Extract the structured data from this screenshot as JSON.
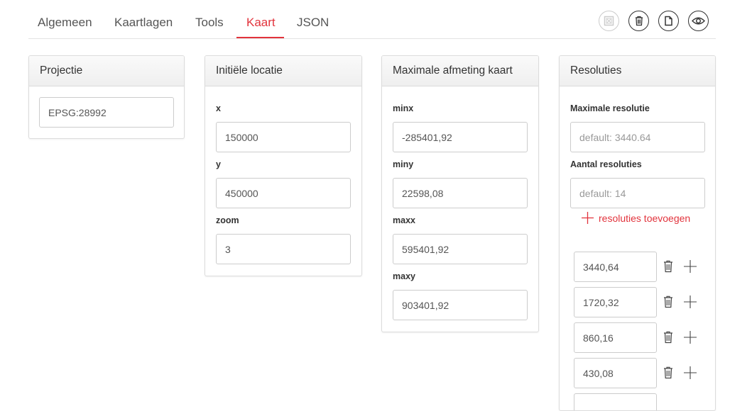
{
  "tabs": [
    {
      "label": "Algemeen"
    },
    {
      "label": "Kaartlagen"
    },
    {
      "label": "Tools"
    },
    {
      "label": "Kaart",
      "active": true
    },
    {
      "label": "JSON"
    }
  ],
  "toolbar": {
    "icons": [
      "close-box-icon",
      "trash-icon",
      "document-icon",
      "eye-icon"
    ]
  },
  "projectie": {
    "title": "Projectie",
    "value": "EPSG:28992"
  },
  "locatie": {
    "title": "Initiële locatie",
    "x_label": "x",
    "x_value": "150000",
    "y_label": "y",
    "y_value": "450000",
    "zoom_label": "zoom",
    "zoom_value": "3"
  },
  "afmeting": {
    "title": "Maximale afmeting kaart",
    "minx_label": "minx",
    "minx_value": "-285401,92",
    "miny_label": "miny",
    "miny_value": "22598,08",
    "maxx_label": "maxx",
    "maxx_value": "595401,92",
    "maxy_label": "maxy",
    "maxy_value": "903401,92"
  },
  "resoluties": {
    "title": "Resoluties",
    "max_label": "Maximale resolutie",
    "max_placeholder": "default: 3440.64",
    "count_label": "Aantal resoluties",
    "count_placeholder": "default: 14",
    "add_label": "resoluties toevoegen",
    "values": [
      "3440,64",
      "1720,32",
      "860,16",
      "430,08",
      ""
    ]
  },
  "colors": {
    "accent": "#e2333c",
    "text": "#333333",
    "border": "#dcdcdc"
  }
}
